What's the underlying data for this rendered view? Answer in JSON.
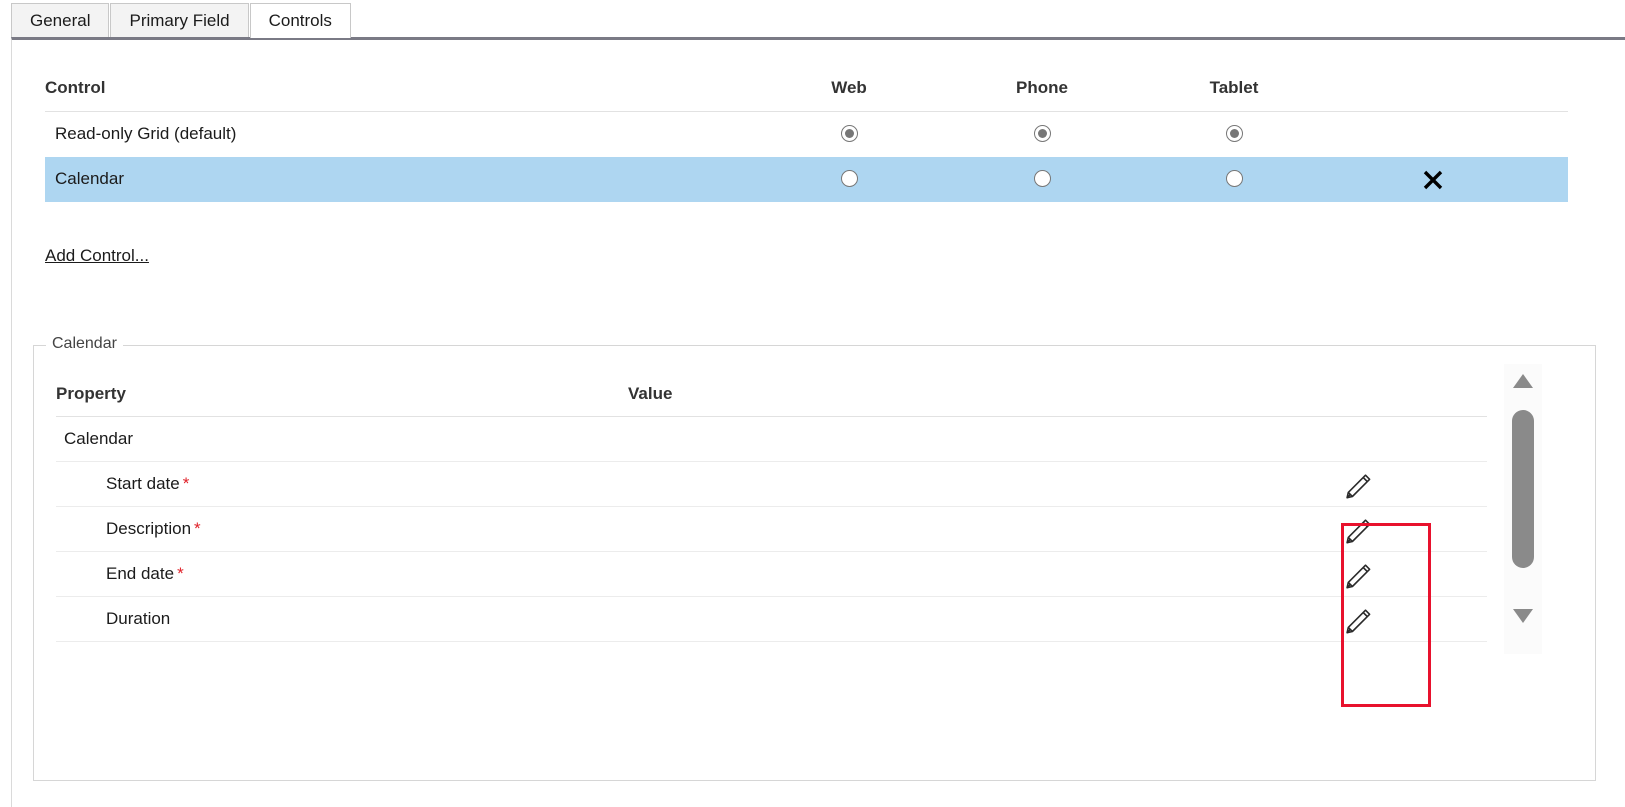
{
  "tabs": [
    {
      "label": "General",
      "active": false
    },
    {
      "label": "Primary Field",
      "active": false
    },
    {
      "label": "Controls",
      "active": true
    }
  ],
  "controls_table": {
    "headers": {
      "control": "Control",
      "web": "Web",
      "phone": "Phone",
      "tablet": "Tablet"
    },
    "rows": [
      {
        "name": "Read-only Grid (default)",
        "web_selected": true,
        "phone_selected": true,
        "tablet_selected": true,
        "selected_row": false,
        "has_delete": false
      },
      {
        "name": "Calendar",
        "web_selected": false,
        "phone_selected": false,
        "tablet_selected": false,
        "selected_row": true,
        "has_delete": true
      }
    ],
    "delete_icon": "close-x-icon",
    "add_control_link": "Add Control..."
  },
  "properties_panel": {
    "legend": "Calendar",
    "headers": {
      "property": "Property",
      "value": "Value"
    },
    "rows": [
      {
        "label": "Calendar",
        "required": false,
        "indent": 0,
        "value": "",
        "has_edit": false
      },
      {
        "label": "Start date",
        "required": true,
        "indent": 1,
        "value": "",
        "has_edit": true
      },
      {
        "label": "Description",
        "required": true,
        "indent": 1,
        "value": "",
        "has_edit": true
      },
      {
        "label": "End date",
        "required": true,
        "indent": 1,
        "value": "",
        "has_edit": true
      },
      {
        "label": "Duration",
        "required": false,
        "indent": 1,
        "value": "",
        "has_edit": true
      }
    ],
    "required_marker": "*",
    "edit_icon": "pencil-icon",
    "scrollbar": {
      "up_icon": "triangle-up-icon",
      "down_icon": "triangle-down-icon",
      "thumb": "scroll-thumb"
    }
  },
  "annotation": {
    "highlight_box_color": "#e8112d"
  },
  "colors": {
    "selected_row": "#aed6f1",
    "required_star": "#e02028",
    "header_text": "#333333",
    "panel_top_border": "#7a7a85"
  }
}
